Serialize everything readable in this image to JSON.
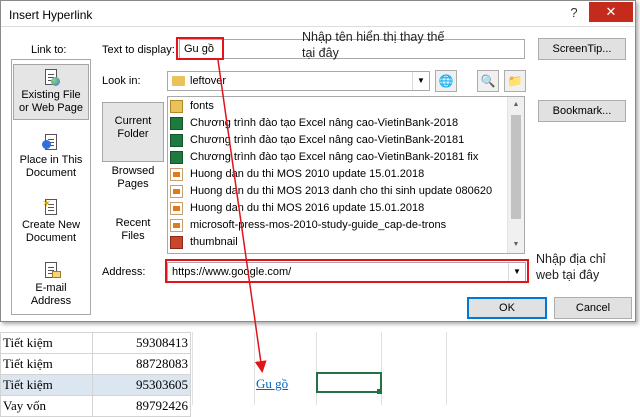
{
  "dialog": {
    "title": "Insert Hyperlink",
    "help_glyph": "?",
    "close_glyph": "✕"
  },
  "link_to": {
    "label": "Link to:",
    "items": [
      {
        "label_line1": "Existing File",
        "label_line2": "or Web Page",
        "selected": true
      },
      {
        "label_line1": "Place in This",
        "label_line2": "Document",
        "selected": false
      },
      {
        "label_line1": "Create New",
        "label_line2": "Document",
        "selected": false
      },
      {
        "label_line1": "E-mail",
        "label_line2": "Address",
        "selected": false
      }
    ]
  },
  "text_to_display": {
    "label": "Text to display:",
    "value": "Gu gồ"
  },
  "screentip_button": "ScreenTip...",
  "look_in": {
    "label": "Look in:",
    "value": "leftover"
  },
  "categories": [
    {
      "line1": "Current",
      "line2": "Folder",
      "selected": true
    },
    {
      "line1": "Browsed",
      "line2": "Pages",
      "selected": false
    },
    {
      "line1": "Recent",
      "line2": "Files",
      "selected": false
    }
  ],
  "bookmark_button": "Bookmark...",
  "files": [
    {
      "name": "fonts",
      "type": "folder"
    },
    {
      "name": "Chương trình đào tạo Excel nâng cao-VietinBank-2018",
      "type": "xls"
    },
    {
      "name": "Chương trình đào tạo Excel nâng cao-VietinBank-20181",
      "type": "xls"
    },
    {
      "name": "Chương trình đào tạo Excel nâng cao-VietinBank-20181 fix",
      "type": "xls"
    },
    {
      "name": "Huong dan du thi MOS  2010 update  15.01.2018",
      "type": "pdf"
    },
    {
      "name": "Huong dan du thi MOS 2013 danh cho thi sinh  update 080620",
      "type": "pdf"
    },
    {
      "name": "Huong dan du thi MOS 2016 update 15.01.2018",
      "type": "pdf"
    },
    {
      "name": "microsoft-press-mos-2010-study-guide_cap-de-trons",
      "type": "pdf"
    },
    {
      "name": "thumbnail",
      "type": "ppt"
    }
  ],
  "address": {
    "label": "Address:",
    "value": "https://www.google.com/"
  },
  "ok_button": "OK",
  "cancel_button": "Cancel",
  "annotations": {
    "display_text_note_line1": "Nhập tên hiển thị thay thế",
    "display_text_note_line2": "tại đây",
    "address_note_line1": "Nhập địa chỉ",
    "address_note_line2": "web tại đây",
    "box_color": "#e1141c"
  },
  "sheet": {
    "rows": [
      {
        "label": "Tiết kiệm",
        "value": "59308413"
      },
      {
        "label": "Tiết kiệm",
        "value": "88728083"
      },
      {
        "label": "Tiết kiệm",
        "value": "95303605"
      },
      {
        "label": "Vay vốn",
        "value": "89792426"
      }
    ],
    "hyperlink_text": "Gu gồ",
    "link_color": "#0563c1"
  }
}
